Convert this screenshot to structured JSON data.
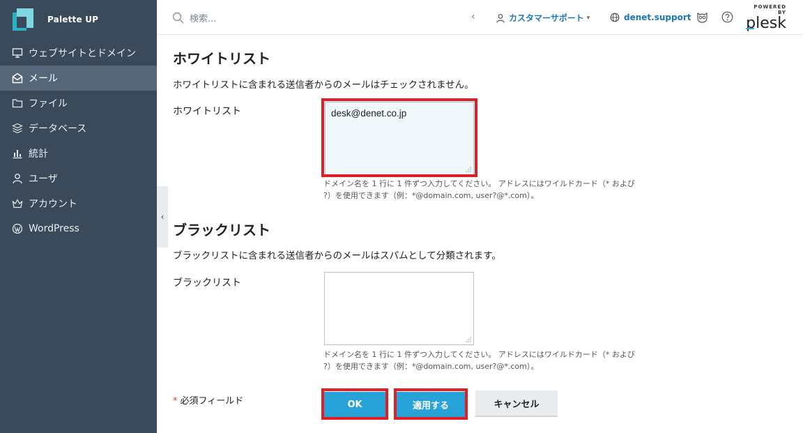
{
  "brand": {
    "name": "Palette UP"
  },
  "sidebar": {
    "items": [
      {
        "label": "ウェブサイトとドメイン",
        "icon": "monitor-icon"
      },
      {
        "label": "メール",
        "icon": "mail-icon",
        "active": true
      },
      {
        "label": "ファイル",
        "icon": "folder-icon"
      },
      {
        "label": "データベース",
        "icon": "database-icon"
      },
      {
        "label": "統計",
        "icon": "chart-icon"
      },
      {
        "label": "ユーザ",
        "icon": "user-icon"
      },
      {
        "label": "アカウント",
        "icon": "account-icon"
      },
      {
        "label": "WordPress",
        "icon": "wordpress-icon"
      }
    ]
  },
  "topbar": {
    "search_placeholder": "検索...",
    "support_label": "カスタマーサポート",
    "domain_label": "denet.support",
    "plesk_powered": "POWERED BY",
    "plesk_name": "plesk"
  },
  "whitelist": {
    "title": "ホワイトリスト",
    "description": "ホワイトリストに含まれる送信者からのメールはチェックされません。",
    "field_label": "ホワイトリスト",
    "value": "desk@denet.co.jp",
    "hint_line1": "ドメイン名を 1 行に 1 件ずつ入力してください。 アドレスにはワイルドカード（* および",
    "hint_line2": "?）を使用できます（例：*@domain.com, user?@*.com）。"
  },
  "blacklist": {
    "title": "ブラックリスト",
    "description": "ブラックリストに含まれる送信者からのメールはスパムとして分類されます。",
    "field_label": "ブラックリスト",
    "value": "",
    "hint_line1": "ドメイン名を 1 行に 1 件ずつ入力してください。 アドレスにはワイルドカード（* および",
    "hint_line2": "?）を使用できます（例：*@domain.com, user?@*.com）。"
  },
  "form": {
    "required_star": "*",
    "required_label": "必須フィールド",
    "ok_label": "OK",
    "apply_label": "適用する",
    "cancel_label": "キャンセル"
  },
  "colors": {
    "sidebar_bg": "#3b4a5a",
    "sidebar_active": "#566779",
    "accent": "#28a3da",
    "link": "#1b77b8",
    "highlight_border": "#e01e25"
  }
}
